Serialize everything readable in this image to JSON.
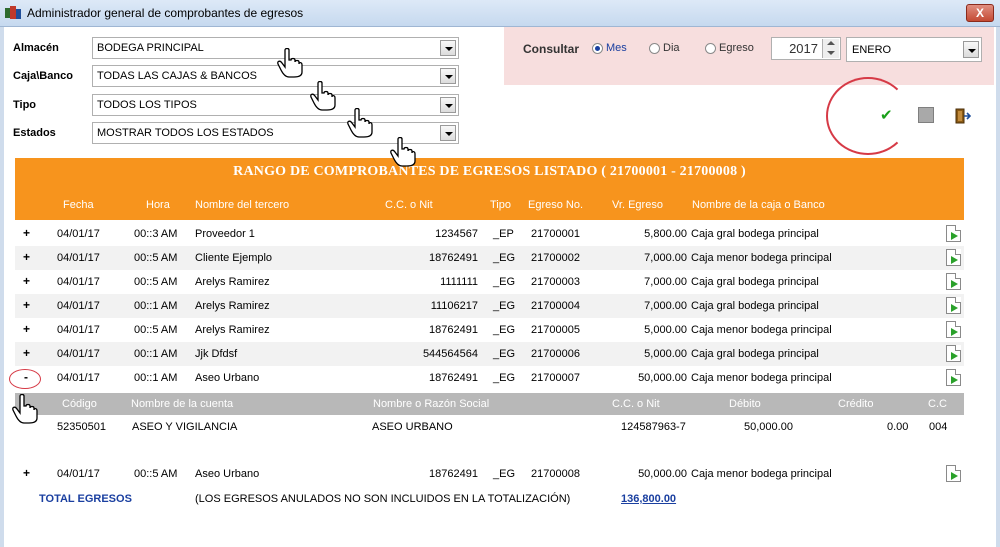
{
  "window": {
    "title": "Administrador general de comprobantes de egresos",
    "close_label": "X"
  },
  "filters": [
    {
      "label": "Almacén",
      "value": "BODEGA PRINCIPAL"
    },
    {
      "label": "Caja\\Banco",
      "value": "TODAS LAS CAJAS & BANCOS"
    },
    {
      "label": "Tipo",
      "value": "TODOS LOS TIPOS"
    },
    {
      "label": "Estados",
      "value": "MOSTRAR TODOS LOS ESTADOS"
    }
  ],
  "consultar": {
    "label": "Consultar",
    "options": [
      "Mes",
      "Dia",
      "Egreso"
    ],
    "selected": "Mes",
    "year": "2017",
    "month": "ENERO"
  },
  "banner": "RANGO DE COMPROBANTES DE EGRESOS LISTADO ( 21700001 - 21700008 )",
  "columns": [
    "Fecha",
    "Hora",
    "Nombre del tercero",
    "C.C. o Nit",
    "Tipo",
    "Egreso No.",
    "Vr. Egreso",
    "Nombre de la caja o Banco"
  ],
  "rows": [
    {
      "exp": "+",
      "fecha": "04/01/17",
      "hora": "00::3 AM",
      "tercero": "Proveedor 1",
      "nit": "1234567",
      "tipo": "_EP",
      "egreso": "21700001",
      "valor": "5,800.00",
      "caja": "Caja gral bodega principal"
    },
    {
      "exp": "+",
      "fecha": "04/01/17",
      "hora": "00::5 AM",
      "tercero": "Cliente Ejemplo",
      "nit": "18762491",
      "tipo": "_EG",
      "egreso": "21700002",
      "valor": "7,000.00",
      "caja": "Caja menor bodega principal"
    },
    {
      "exp": "+",
      "fecha": "04/01/17",
      "hora": "00::5 AM",
      "tercero": "Arelys Ramirez",
      "nit": "1111111",
      "tipo": "_EG",
      "egreso": "21700003",
      "valor": "7,000.00",
      "caja": "Caja gral bodega principal"
    },
    {
      "exp": "+",
      "fecha": "04/01/17",
      "hora": "00::1 AM",
      "tercero": "Arelys Ramirez",
      "nit": "11106217",
      "tipo": "_EG",
      "egreso": "21700004",
      "valor": "7,000.00",
      "caja": "Caja gral bodega principal"
    },
    {
      "exp": "+",
      "fecha": "04/01/17",
      "hora": "00::5 AM",
      "tercero": "Arelys Ramirez",
      "nit": "18762491",
      "tipo": "_EG",
      "egreso": "21700005",
      "valor": "5,000.00",
      "caja": "Caja menor bodega principal"
    },
    {
      "exp": "+",
      "fecha": "04/01/17",
      "hora": "00::1 AM",
      "tercero": "Jjk Dfdsf",
      "nit": "544564564",
      "tipo": "_EG",
      "egreso": "21700006",
      "valor": "5,000.00",
      "caja": "Caja gral bodega principal"
    },
    {
      "exp": "-",
      "fecha": "04/01/17",
      "hora": "00::1 AM",
      "tercero": "Aseo Urbano",
      "nit": "18762491",
      "tipo": "_EG",
      "egreso": "21700007",
      "valor": "50,000.00",
      "caja": "Caja menor bodega principal"
    }
  ],
  "detail": {
    "columns": [
      "Código",
      "Nombre de la cuenta",
      "Nombre o Razón Social",
      "C.C. o Nit",
      "Débito",
      "Crédito",
      "C.C"
    ],
    "row": {
      "codigo": "52350501",
      "cuenta": "ASEO Y VIGILANCIA",
      "razon": "ASEO URBANO",
      "nit": "124587963-7",
      "debito": "50,000.00",
      "credito": "0.00",
      "cc": "004"
    }
  },
  "last_row": {
    "exp": "+",
    "fecha": "04/01/17",
    "hora": "00::5 AM",
    "tercero": "Aseo Urbano",
    "nit": "18762491",
    "tipo": "_EG",
    "egreso": "21700008",
    "valor": "50,000.00",
    "caja": "Caja menor bodega principal"
  },
  "total": {
    "label": "TOTAL EGRESOS",
    "note": "(LOS EGRESOS ANULADOS NO SON INCLUIDOS EN LA TOTALIZACIÓN)",
    "amount": "136,800.00"
  },
  "colors": {
    "accent": "#f7941d",
    "link": "#1a3fa0",
    "panel": "#f7dede",
    "annotation": "#d63a46"
  }
}
